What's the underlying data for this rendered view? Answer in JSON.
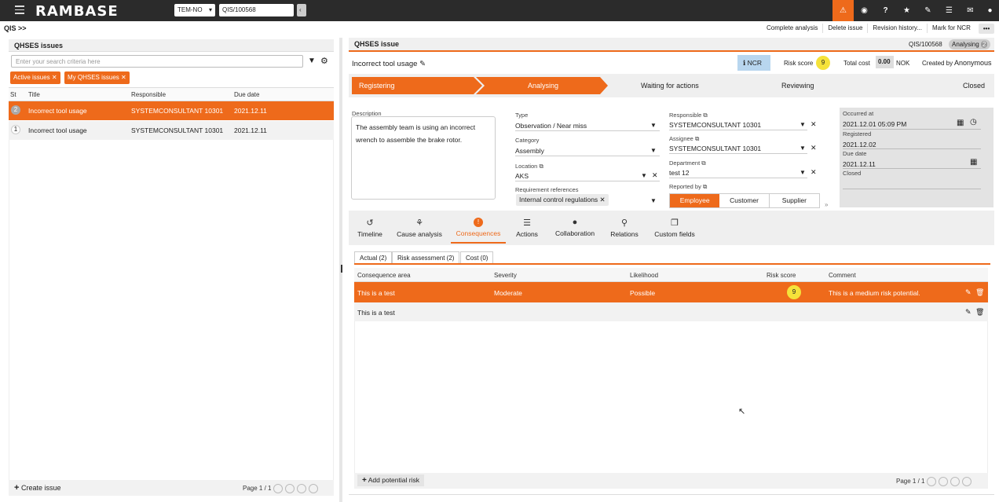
{
  "topbar": {
    "logo": "RAMBASE",
    "company": "TEM-NO",
    "doc_id": "QIS/100568"
  },
  "breadcrumb": "QIS >>",
  "header_actions": [
    "Complete analysis",
    "Delete issue",
    "Revision history...",
    "Mark for NCR",
    "•••"
  ],
  "left": {
    "title": "QHSES issues",
    "search_placeholder": "Enter your search criteria here",
    "filters": [
      "Active issues",
      "My QHSES issues"
    ],
    "columns": [
      "St",
      "Title",
      "Responsible",
      "Due date"
    ],
    "rows": [
      {
        "st": "2",
        "title": "Incorrect tool usage",
        "responsible": "SYSTEMCONSULTANT 10301",
        "due": "2021.12.11"
      },
      {
        "st": "1",
        "title": "Incorrect tool usage",
        "responsible": "SYSTEMCONSULTANT 10301",
        "due": "2021.12.11"
      }
    ],
    "create_label": "Create issue",
    "pager": "Page 1 / 1"
  },
  "right": {
    "title": "QHSES issue",
    "doc_id": "QIS/100568",
    "status": "Analysing",
    "status_num": "2",
    "issue_title": "Incorrect tool usage",
    "ncr": "NCR",
    "risk_label": "Risk score",
    "risk_value": "9",
    "cost_label": "Total cost",
    "cost_value": "0.00",
    "currency": "NOK",
    "created_by_label": "Created by",
    "created_by": "Anonymous",
    "steps": [
      "Registering",
      "Analysing",
      "Waiting for actions",
      "Reviewing",
      "Closed"
    ],
    "desc_label": "Description",
    "desc_text": "The assembly team is using an incorrect wrench to assemble the brake rotor.",
    "type_label": "Type",
    "type_value": "Observation / Near miss",
    "category_label": "Category",
    "category_value": "Assembly",
    "location_label": "Location",
    "location_value": "AKS",
    "req_label": "Requirement references",
    "req_value": "Internal control regulations",
    "resp_label": "Responsible",
    "resp_value": "SYSTEMCONSULTANT 10301",
    "assignee_label": "Assignee",
    "assignee_value": "SYSTEMCONSULTANT 10301",
    "dept_label": "Department",
    "dept_value": "test 12",
    "reported_label": "Reported by",
    "reported_options": [
      "Employee",
      "Customer",
      "Supplier"
    ],
    "occurred_label": "Occurred at",
    "occurred_value": "2021.12.01 05:09 PM",
    "registered_label": "Registered",
    "registered_value": "2021.12.02",
    "due_label": "Due date",
    "due_value": "2021.12.11",
    "closed_label": "Closed",
    "tabs": [
      "Timeline",
      "Cause analysis",
      "Consequences",
      "Actions",
      "Collaboration",
      "Relations",
      "Custom fields"
    ],
    "subtabs": [
      "Actual (2)",
      "Risk assessment (2)",
      "Cost (0)"
    ],
    "grid_cols": [
      "Consequence area",
      "Severity",
      "Likelihood",
      "Risk score",
      "Comment"
    ],
    "grid_rows": [
      {
        "area": "This is a test",
        "severity": "Moderate",
        "likelihood": "Possible",
        "score": "9",
        "comment": "This is a medium risk potential."
      },
      {
        "area": "This is a test",
        "severity": "",
        "likelihood": "",
        "score": "",
        "comment": ""
      }
    ],
    "add_label": "Add potential risk",
    "pager": "Page 1 / 1"
  },
  "colors": {
    "accent": "#ee6a1b",
    "dark": "#2b2b2b",
    "badge": "#f5e23a"
  }
}
